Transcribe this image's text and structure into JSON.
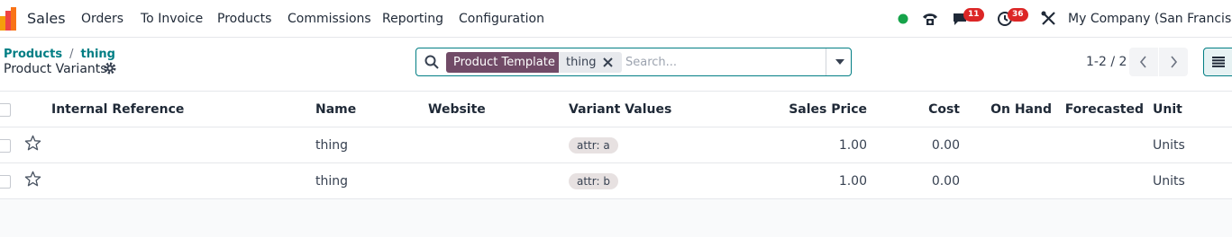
{
  "navbar": {
    "app_name": "Sales",
    "menu": [
      "Orders",
      "To Invoice",
      "Products",
      "Commissions",
      "Reporting",
      "Configuration"
    ],
    "status_color": "#16a34a",
    "messages_count": "11",
    "activities_count": "36",
    "company": "My Company (San Francisco)"
  },
  "breadcrumb": {
    "parent": "Products",
    "current": "thing"
  },
  "page_title": "Product Variants",
  "search": {
    "facet_label": "Product Template",
    "facet_value": "thing",
    "placeholder": "Search..."
  },
  "pager": {
    "text": "1-2 / 2"
  },
  "table": {
    "columns": [
      "Internal Reference",
      "Name",
      "Website",
      "Variant Values",
      "Sales Price",
      "Cost",
      "On Hand",
      "Forecasted",
      "Unit"
    ],
    "rows": [
      {
        "internal_reference": "",
        "name": "thing",
        "website": "",
        "variant": "attr: a",
        "sales_price": "1.00",
        "cost": "0.00",
        "on_hand": "",
        "forecasted": "",
        "unit": "Units"
      },
      {
        "internal_reference": "",
        "name": "thing",
        "website": "",
        "variant": "attr: b",
        "sales_price": "1.00",
        "cost": "0.00",
        "on_hand": "",
        "forecasted": "",
        "unit": "Units"
      }
    ]
  },
  "colors": {
    "accent": "#017e84",
    "brand": "#714b67",
    "badge": "#dc2626"
  }
}
